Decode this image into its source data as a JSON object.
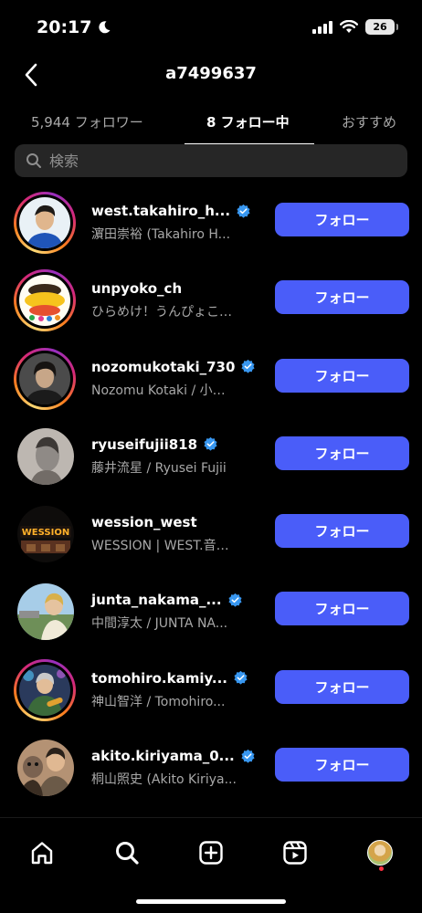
{
  "status_bar": {
    "time": "20:17",
    "battery": "26"
  },
  "header": {
    "title": "a7499637"
  },
  "tabs": [
    {
      "label": "5,944 フォロワー",
      "active": false
    },
    {
      "label": "8 フォロー中",
      "active": true
    },
    {
      "label": "おすすめ",
      "active": false
    }
  ],
  "search": {
    "placeholder": "検索"
  },
  "colors": {
    "follow_button": "#4a5df9",
    "verified": "#3897f0",
    "background": "#000000"
  },
  "following": [
    {
      "username": "west.takahiro_h...",
      "subtitle": "濵田崇裕 (Takahiro H...",
      "verified": true,
      "story_ring": true,
      "button": "フォロー"
    },
    {
      "username": "unpyoko_ch",
      "subtitle": "ひらめけ！うんぴょこ…",
      "verified": false,
      "story_ring": true,
      "button": "フォロー"
    },
    {
      "username": "nozomukotaki_730",
      "subtitle": "Nozomu Kotaki / 小…",
      "verified": true,
      "story_ring": true,
      "button": "フォロー"
    },
    {
      "username": "ryuseifujii818",
      "subtitle": "藤井流星 / Ryusei Fujii",
      "verified": true,
      "story_ring": false,
      "button": "フォロー"
    },
    {
      "username": "wession_west",
      "subtitle": "WESSION | WEST.音…",
      "verified": false,
      "story_ring": false,
      "button": "フォロー"
    },
    {
      "username": "junta_nakama_...",
      "subtitle": "中間淳太 / JUNTA NA...",
      "verified": true,
      "story_ring": false,
      "button": "フォロー"
    },
    {
      "username": "tomohiro.kamiy...",
      "subtitle": "神山智洋 / Tomohiro...",
      "verified": true,
      "story_ring": true,
      "button": "フォロー"
    },
    {
      "username": "akito.kiriyama_0...",
      "subtitle": "桐山照史 (Akito Kiriya...",
      "verified": true,
      "story_ring": false,
      "button": "フォロー"
    }
  ],
  "bottom_nav": [
    {
      "icon": "home-icon"
    },
    {
      "icon": "search-icon"
    },
    {
      "icon": "create-icon"
    },
    {
      "icon": "reels-icon"
    },
    {
      "icon": "profile-avatar"
    }
  ]
}
